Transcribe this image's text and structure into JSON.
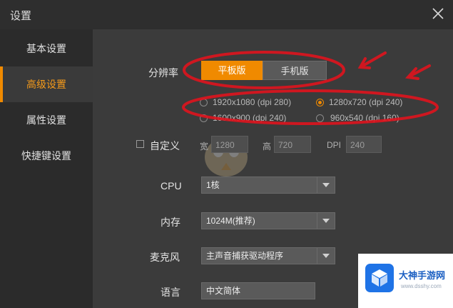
{
  "window": {
    "title": "设置",
    "close_icon": "close-icon"
  },
  "sidebar": {
    "items": [
      {
        "label": "基本设置",
        "active": false
      },
      {
        "label": "高级设置",
        "active": true
      },
      {
        "label": "属性设置",
        "active": false
      },
      {
        "label": "快捷键设置",
        "active": false
      }
    ]
  },
  "resolution": {
    "label": "分辨率",
    "tabs": [
      {
        "label": "平板版",
        "selected": true
      },
      {
        "label": "手机版",
        "selected": false
      }
    ],
    "options": [
      {
        "label": "1920x1080 (dpi 280)",
        "selected": false
      },
      {
        "label": "1280x720 (dpi 240)",
        "selected": true
      },
      {
        "label": "1600x900 (dpi 240)",
        "selected": false
      },
      {
        "label": "960x540 (dpi 160)",
        "selected": false
      }
    ]
  },
  "custom": {
    "label": "自定义",
    "checked": false,
    "width_label": "宽",
    "width_value": "1280",
    "height_label": "高",
    "height_value": "720",
    "dpi_label": "DPI",
    "dpi_value": "240"
  },
  "cpu": {
    "label": "CPU",
    "value": "1核"
  },
  "memory": {
    "label": "内存",
    "value": "1024M(推荐)"
  },
  "mic": {
    "label": "麦克风",
    "value": "主声音捕获驱动程序"
  },
  "language": {
    "label": "语言",
    "value": "中文简体"
  },
  "watermark": {
    "title": "大神手游网",
    "subtitle": "www.dsshy.com"
  },
  "colors": {
    "accent": "#f08a00",
    "annotation": "#e0141e",
    "sidebar_bg": "#2b2b2b",
    "main_bg": "#3b3b3b"
  }
}
